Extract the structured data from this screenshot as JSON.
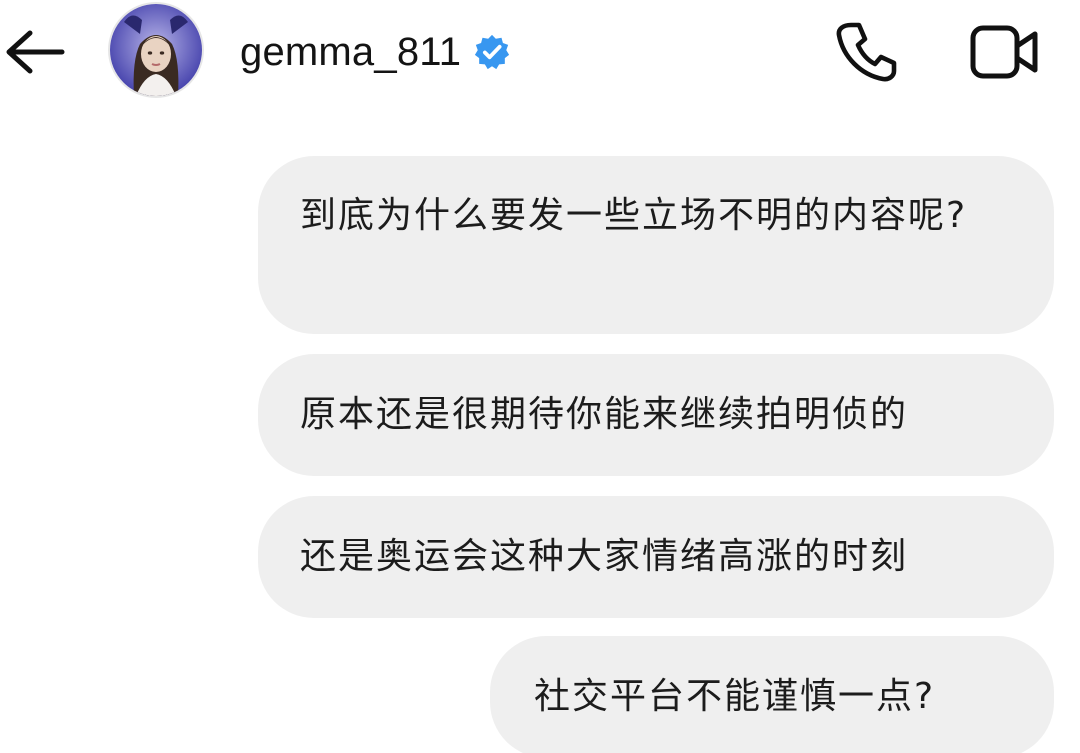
{
  "header": {
    "username": "gemma_811",
    "verified": true,
    "accent_color": "#3897f0",
    "icons": {
      "back": "arrow-left-icon",
      "verified": "verified-badge-icon",
      "call": "phone-icon",
      "video": "video-camera-icon"
    }
  },
  "messages": [
    {
      "text": "到底为什么要发一些立场不明的内容呢?"
    },
    {
      "text": "原本还是很期待你能来继续拍明侦的"
    },
    {
      "text": "还是奥运会这种大家情绪高涨的时刻"
    },
    {
      "text": "社交平台不能谨慎一点?"
    }
  ],
  "colors": {
    "bubble_bg": "#efefef",
    "text": "#1c1c1c"
  }
}
